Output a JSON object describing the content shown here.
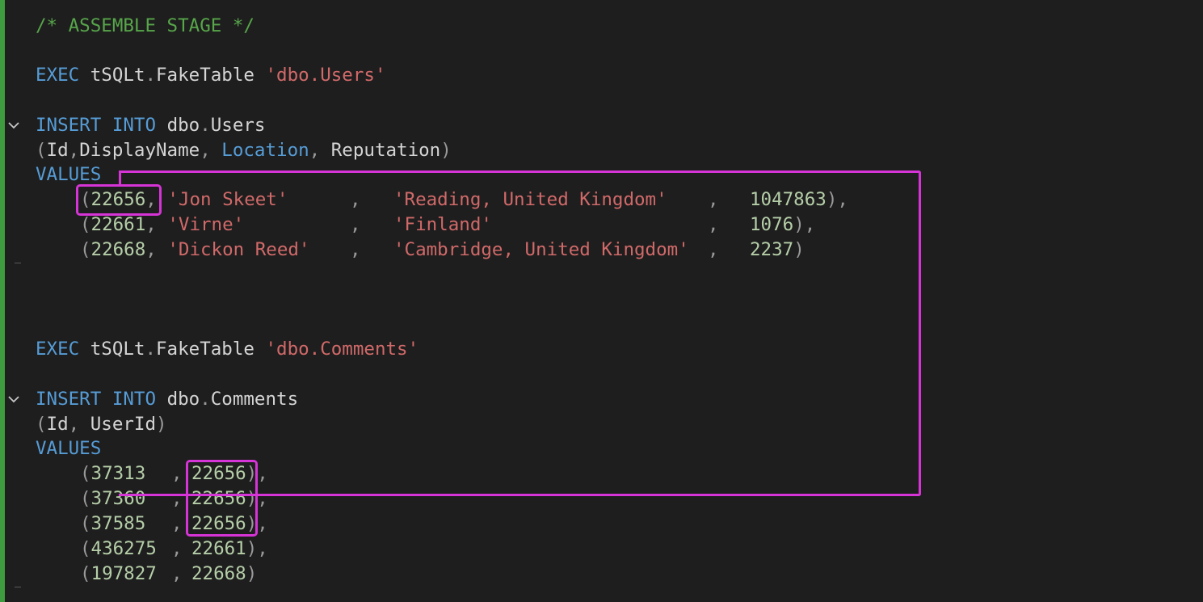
{
  "colors": {
    "background": "#1e1e1e",
    "gutter_bar": "#3e9c3e",
    "keyword": "#569cd6",
    "string": "#d16969",
    "number": "#b5cea8",
    "comment": "#57a64a",
    "text": "#d4d4d4",
    "highlight": "#d634d6"
  },
  "icons": {
    "fold": "chevron-down-icon"
  },
  "code": {
    "l01": {
      "comment": "/* ASSEMBLE STAGE */"
    },
    "l03": {
      "kw": "EXEC",
      "ident": "tSQLt",
      "dot": ".",
      "fn": "FakeTable",
      "str": "'dbo.Users'"
    },
    "l05": {
      "kw": "INSERT INTO",
      "schema": "dbo",
      "dot": ".",
      "table": "Users"
    },
    "l06": {
      "open": "(",
      "c1": "Id",
      "s1": ",",
      "c2": "DisplayName",
      "s2": ", ",
      "c3": "Location",
      "s3": ", ",
      "c4": "Reputation",
      "close": ")"
    },
    "l07": {
      "kw": "VALUES"
    },
    "l08": {
      "open": "(",
      "id": "22656",
      "s1": ",",
      "name": "'Jon Skeet'",
      "s2": ",",
      "loc": "'Reading, United Kingdom'",
      "s3": ",",
      "rep": "1047863",
      "close": "),"
    },
    "l09": {
      "open": "(",
      "id": "22661",
      "s1": ",",
      "name": "'Virne'",
      "s2": ",",
      "loc": "'Finland'",
      "s3": ",",
      "rep": "1076",
      "close": "),"
    },
    "l10": {
      "open": "(",
      "id": "22668",
      "s1": ",",
      "name": "'Dickon Reed'",
      "s2": ",",
      "loc": "'Cambridge, United Kingdom'",
      "s3": ",",
      "rep": "2237",
      "close": ")"
    },
    "l14": {
      "kw": "EXEC",
      "ident": "tSQLt",
      "dot": ".",
      "fn": "FakeTable",
      "str": "'dbo.Comments'"
    },
    "l16": {
      "kw": "INSERT INTO",
      "schema": "dbo",
      "dot": ".",
      "table": "Comments"
    },
    "l17": {
      "open": "(",
      "c1": "Id",
      "s1": ", ",
      "c2": "UserId",
      "close": ")"
    },
    "l18": {
      "kw": "VALUES"
    },
    "rows": [
      {
        "open": "(",
        "id": "37313",
        "sep": ",",
        "uid": "22656",
        "close": "),"
      },
      {
        "open": "(",
        "id": "37360",
        "sep": ",",
        "uid": "22656",
        "close": "),"
      },
      {
        "open": "(",
        "id": "37585",
        "sep": ",",
        "uid": "22656",
        "close": "),"
      },
      {
        "open": "(",
        "id": "436275",
        "sep": ",",
        "uid": "22661",
        "close": "),"
      },
      {
        "open": "(",
        "id": "197827",
        "sep": ",",
        "uid": "22668",
        "close": ")"
      }
    ]
  }
}
